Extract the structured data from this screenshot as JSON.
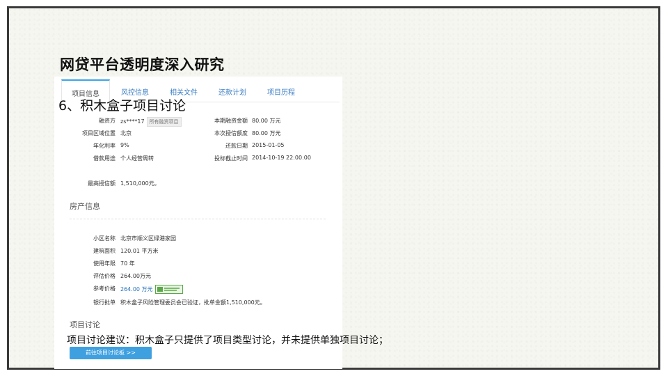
{
  "slide": {
    "title": "网贷平台透明度深入研究",
    "heading": "6、积木盒子项目讨论",
    "note": "项目讨论建议：积木盒子只提供了项目类型讨论，并未提供单独项目讨论；"
  },
  "screenshot": {
    "tabs": [
      "项目信息",
      "风控信息",
      "相关文件",
      "还款计划",
      "项目历程"
    ],
    "left_fields": [
      {
        "label": "融资方",
        "value": "zs****17",
        "tag": "所有融资项目"
      },
      {
        "label": "项目区域位置",
        "value": "北京"
      },
      {
        "label": "年化利率",
        "value": "9%"
      },
      {
        "label": "借款用途",
        "value": "个人经营周转"
      }
    ],
    "right_fields": [
      {
        "label": "本期融资金额",
        "value": "80.00 万元"
      },
      {
        "label": "本次授信额度",
        "value": "80.00 万元"
      },
      {
        "label": "还款日期",
        "value": "2015-01-05"
      },
      {
        "label": "投标截止时间",
        "value": "2014-10-19 22:00:00"
      }
    ],
    "max_credit": {
      "label": "最高授信额",
      "value": "1,510,000元。"
    },
    "property_section": "房产信息",
    "property_fields": [
      {
        "label": "小区名称",
        "value": "北京市顺义区绿港家园"
      },
      {
        "label": "建筑面积",
        "value": "120.01 平方米"
      },
      {
        "label": "使用年限",
        "value": "70 年"
      },
      {
        "label": "评估价格",
        "value": "264.00万元"
      },
      {
        "label": "参考价格",
        "value": "264.00 万元"
      },
      {
        "label": "银行批单",
        "value": "积木盒子风险管理委员会已验证，批单金额1,510,000元。"
      }
    ],
    "discussion_section": "项目讨论",
    "discussion_button": "前往项目讨论板 >>"
  }
}
